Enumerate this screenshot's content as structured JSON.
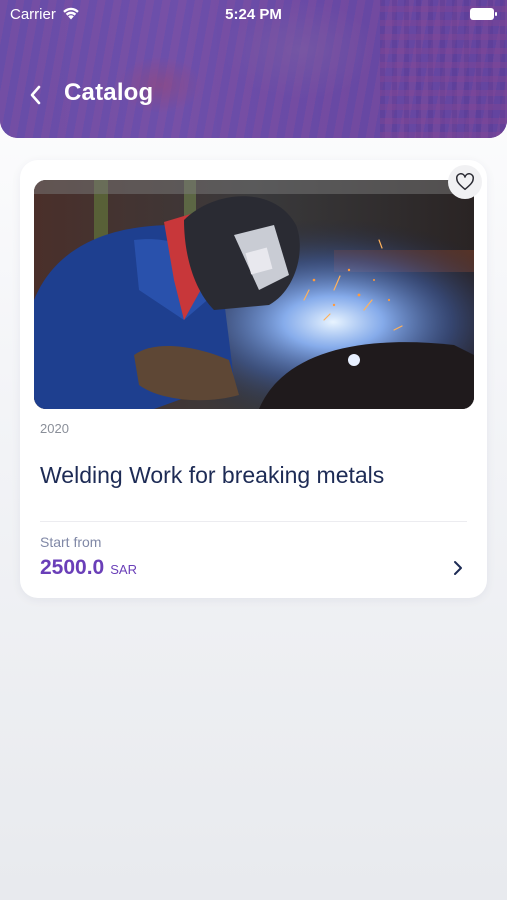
{
  "status_bar": {
    "carrier": "Carrier",
    "time": "5:24 PM"
  },
  "header": {
    "title": "Catalog",
    "back_icon": "chevron-left-icon",
    "background_color": "#6a4ea6"
  },
  "card": {
    "image_icon": "welding-photo",
    "favorite_icon": "heart-outline-icon",
    "year": "2020",
    "title": "Welding Work for breaking metals",
    "start_from_label": "Start from",
    "price": "2500.0",
    "currency": "SAR",
    "chevron_icon": "chevron-right-icon"
  },
  "colors": {
    "accent": "#6a3fb8",
    "title_text": "#1d2b55",
    "muted_text": "#8a8f99"
  }
}
